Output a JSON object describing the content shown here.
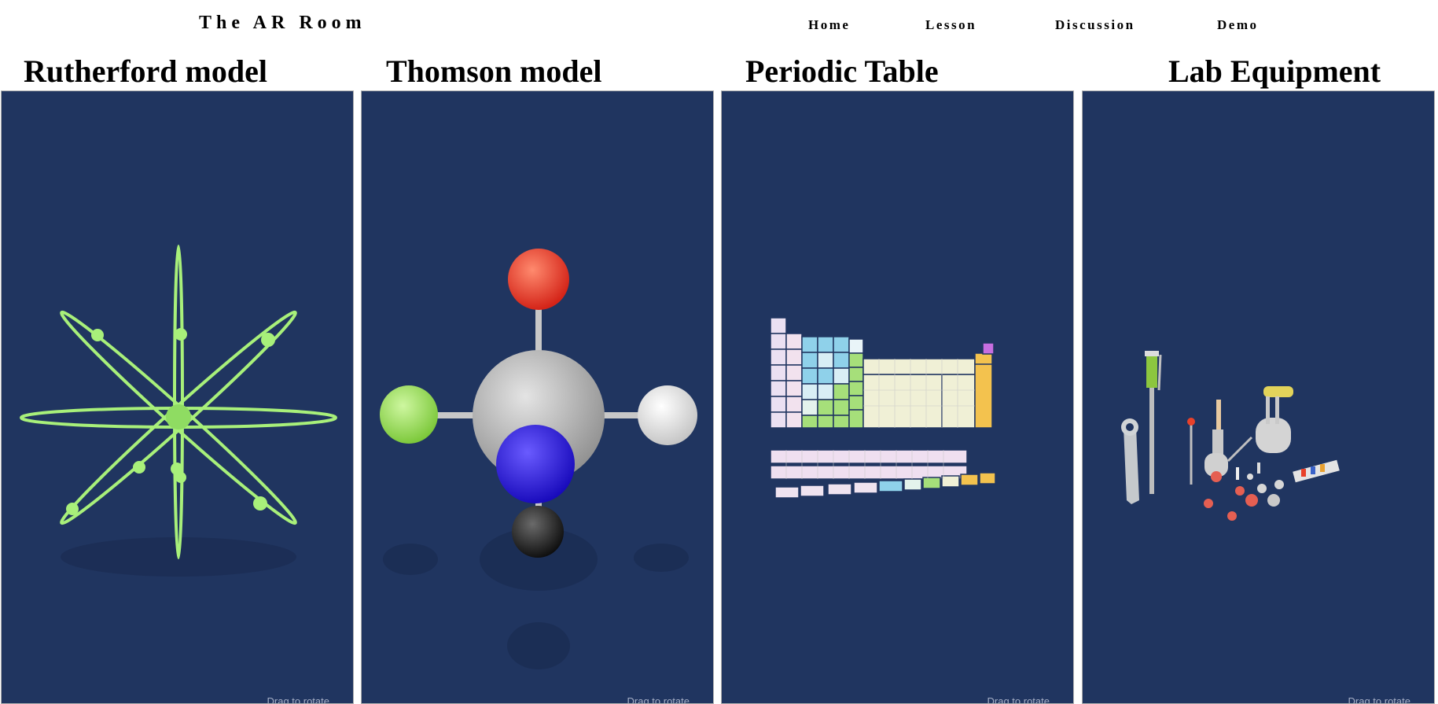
{
  "header": {
    "brand": "The AR Room",
    "nav": [
      {
        "label": "Home"
      },
      {
        "label": "Lesson"
      },
      {
        "label": "Discussion"
      },
      {
        "label": "Demo"
      }
    ]
  },
  "models": [
    {
      "title": "Rutherford model",
      "hint": "Drag to rotate"
    },
    {
      "title": "Thomson model",
      "hint": "Drag to rotate"
    },
    {
      "title": "Periodic Table",
      "hint": "Drag to rotate"
    },
    {
      "title": "Lab Equipment",
      "hint": "Drag to rotate"
    }
  ],
  "colors": {
    "viewer_background": "#203560",
    "orbit_green": "#a8f07a",
    "atom_red": "#e8412a",
    "atom_gray": "#b8b8b8",
    "atom_lightgreen": "#9de05c",
    "atom_white": "#f0f0f0",
    "atom_blue": "#1a0ae0",
    "atom_black": "#151515"
  }
}
